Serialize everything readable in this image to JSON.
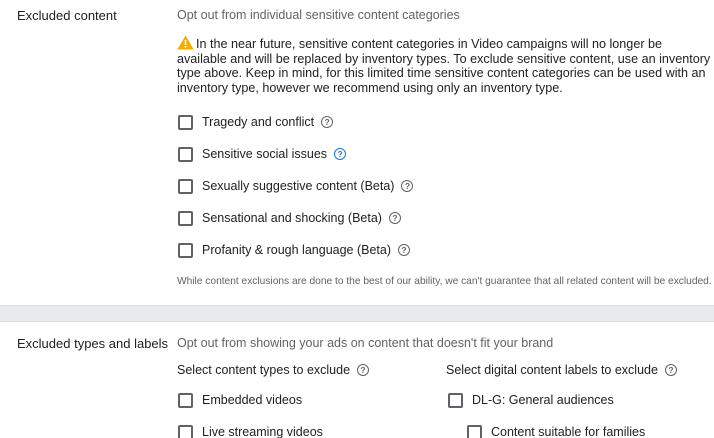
{
  "excluded_content": {
    "title": "Excluded content",
    "subtitle": "Opt out from individual sensitive content categories",
    "warning_text": "In the near future, sensitive content categories in Video campaigns will no longer be available and will be replaced by inventory types. To exclude sensitive content, use an inventory type above. Keep in mind, for this limited time sensitive content categories can be used with an inventory type, however we recommend using only an inventory type.",
    "warning_icon_color": "#f9ab00",
    "categories": [
      {
        "label": "Tragedy and conflict",
        "checked": false
      },
      {
        "label": "Sensitive social issues",
        "checked": false
      },
      {
        "label": "Sexually suggestive content (Beta)",
        "checked": false
      },
      {
        "label": "Sensational and shocking (Beta)",
        "checked": false
      },
      {
        "label": "Profanity & rough language (Beta)",
        "checked": false
      }
    ],
    "disclaimer": "While content exclusions are done to the best of our ability, we can't guarantee that all related content will be excluded."
  },
  "excluded_types": {
    "title": "Excluded types and labels",
    "subtitle": "Opt out from showing your ads on content that doesn't fit your brand",
    "content_types_heading": "Select content types to exclude",
    "labels_heading": "Select digital content labels to exclude",
    "content_types": [
      {
        "label": "Embedded videos",
        "checked": false
      },
      {
        "label": "Live streaming videos",
        "checked": false
      }
    ],
    "labels": [
      {
        "label": "DL-G: General audiences",
        "checked": false
      },
      {
        "label": "Content suitable for families",
        "checked": false
      }
    ]
  },
  "icons": {
    "help": "?",
    "warning": "warning-icon"
  }
}
